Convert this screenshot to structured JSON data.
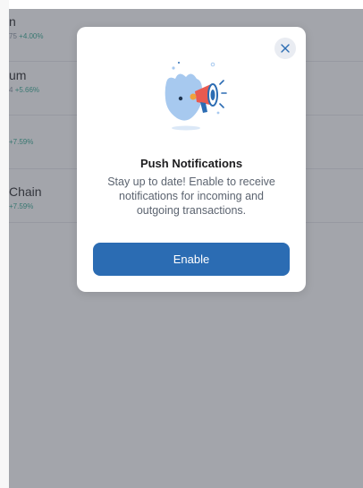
{
  "background_list": {
    "rows": [
      {
        "name": "n",
        "price": "75",
        "change": "+4.00%"
      },
      {
        "name": "um",
        "price": "4",
        "change": "+5.66%"
      },
      {
        "name": "",
        "price": "",
        "change": "+7.59%"
      },
      {
        "name": "Chain",
        "price": "",
        "change": "+7.59%"
      }
    ]
  },
  "modal": {
    "close_icon": "close-icon",
    "illustration": "megaphone-notification-illustration",
    "title": "Push Notifications",
    "body": "Stay up to date! Enable to receive notifications for incoming and outgoing transactions.",
    "enable_label": "Enable"
  },
  "colors": {
    "primary_button": "#2b6cb3",
    "positive_change": "#2ca58d",
    "overlay": "rgba(72,76,88,0.50)",
    "illustration_blue": "#a7c9ef",
    "megaphone_red": "#e95a50"
  }
}
